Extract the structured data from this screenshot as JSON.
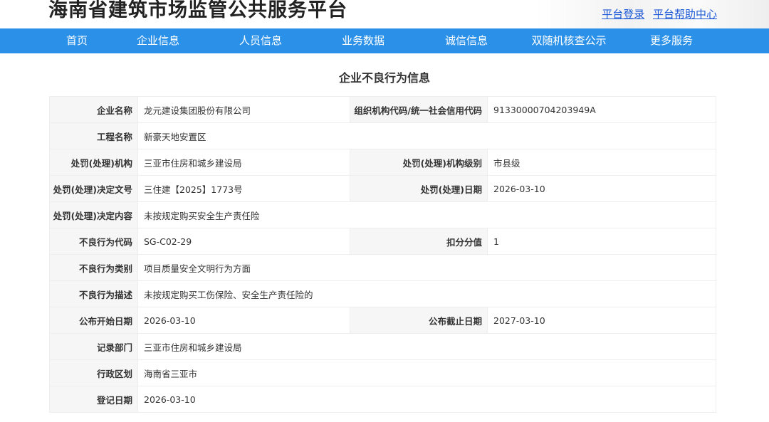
{
  "header": {
    "title": "海南省建筑市场监管公共服务平台",
    "login_link": "平台登录",
    "help_link": "平台帮助中心"
  },
  "nav": {
    "items": [
      "首页",
      "企业信息",
      "人员信息",
      "业务数据",
      "诚信信息",
      "双随机核查公示",
      "更多服务"
    ]
  },
  "main": {
    "heading": "企业不良行为信息",
    "fields": {
      "company_name": {
        "label": "企业名称",
        "value": "龙元建设集团股份有限公司"
      },
      "org_code": {
        "label": "组织机构代码/统一社会信用代码",
        "value": "91330000704203949A"
      },
      "project_name": {
        "label": "工程名称",
        "value": "新豪天地安置区"
      },
      "penalty_org": {
        "label": "处罚(处理)机构",
        "value": "三亚市住房和城乡建设局"
      },
      "penalty_org_level": {
        "label": "处罚(处理)机构级别",
        "value": "市县级"
      },
      "decision_no": {
        "label": "处罚(处理)决定文号",
        "value": "三住建【2025】1773号"
      },
      "penalty_date": {
        "label": "处罚(处理)日期",
        "value": "2026-03-10"
      },
      "decision_content": {
        "label": "处罚(处理)决定内容",
        "value": "未按规定购买安全生产责任险"
      },
      "behavior_code": {
        "label": "不良行为代码",
        "value": "SG-C02-29"
      },
      "deduction": {
        "label": "扣分分值",
        "value": "1"
      },
      "behavior_category": {
        "label": "不良行为类别",
        "value": "项目质量安全文明行为方面"
      },
      "behavior_desc": {
        "label": "不良行为描述",
        "value": "未按规定购买工伤保险、安全生产责任险的"
      },
      "publish_start": {
        "label": "公布开始日期",
        "value": "2026-03-10"
      },
      "publish_end": {
        "label": "公布截止日期",
        "value": "2027-03-10"
      },
      "record_dept": {
        "label": "记录部门",
        "value": "三亚市住房和城乡建设局"
      },
      "region": {
        "label": "行政区划",
        "value": "海南省三亚市"
      },
      "register_date": {
        "label": "登记日期",
        "value": "2026-03-10"
      }
    }
  }
}
